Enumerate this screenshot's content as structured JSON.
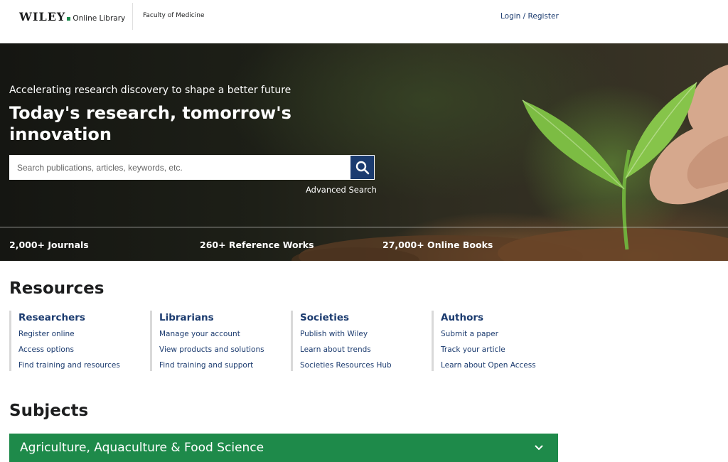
{
  "header": {
    "logo_brand": "WILEY",
    "logo_product": "Online Library",
    "institution": "Faculty of Medicine",
    "login": "Login / Register"
  },
  "hero": {
    "subtitle": "Accelerating research discovery to shape a better future",
    "title": "Today's research, tomorrow's innovation",
    "search_placeholder": "Search publications, articles, keywords, etc.",
    "advanced_search": "Advanced Search",
    "stats": [
      "2,000+ Journals",
      "260+ Reference Works",
      "27,000+ Online Books"
    ]
  },
  "resources": {
    "heading": "Resources",
    "columns": [
      {
        "title": "Researchers",
        "links": [
          "Register online",
          "Access options",
          "Find training and resources"
        ]
      },
      {
        "title": "Librarians",
        "links": [
          "Manage your account",
          "View products and solutions",
          "Find training and support"
        ]
      },
      {
        "title": "Societies",
        "links": [
          "Publish with Wiley",
          "Learn about trends",
          "Societies Resources Hub"
        ]
      },
      {
        "title": "Authors",
        "links": [
          "Submit a paper",
          "Track your article",
          "Learn about Open Access"
        ]
      }
    ]
  },
  "subjects": {
    "heading": "Subjects",
    "items": [
      "Agriculture, Aquaculture & Food Science"
    ]
  },
  "colors": {
    "brand_blue": "#1b3b6f",
    "brand_green": "#1e8a4a"
  },
  "icons": [
    "search-icon",
    "chevron-down-icon"
  ]
}
